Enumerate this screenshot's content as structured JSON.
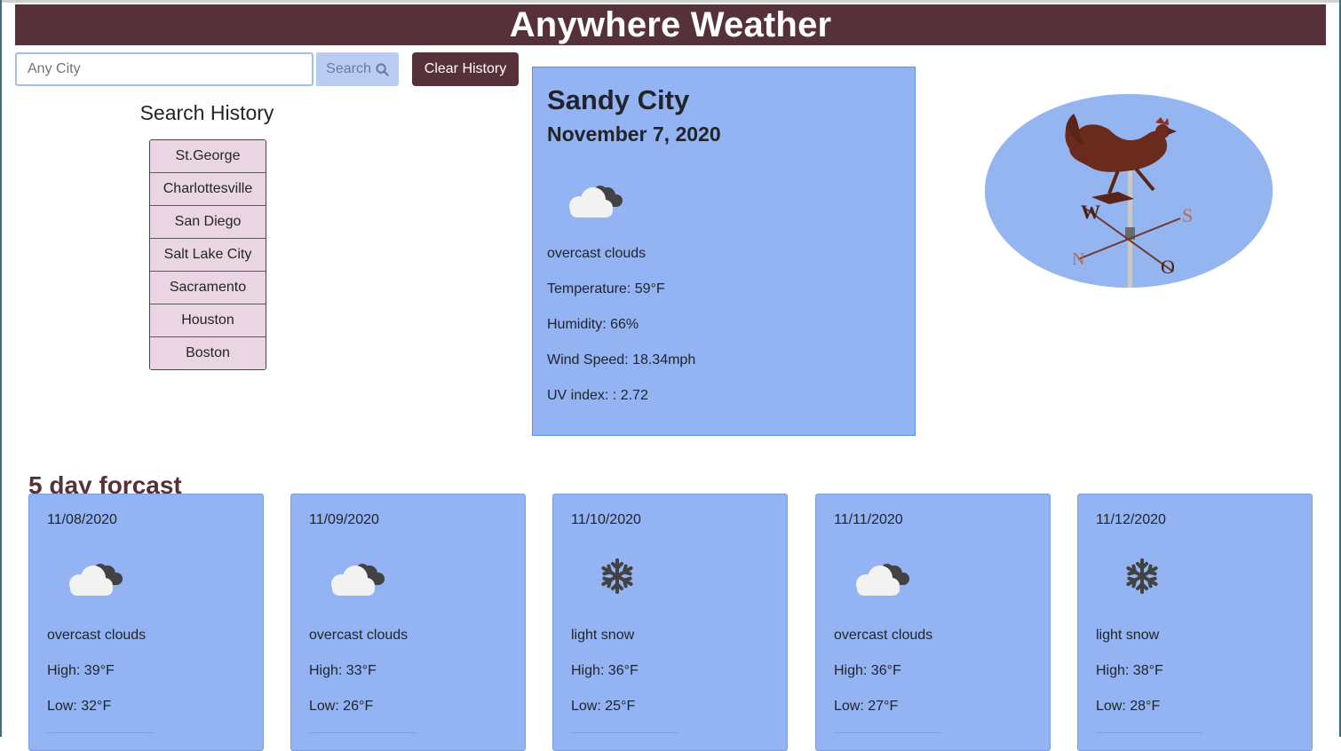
{
  "app": {
    "title": "Anywhere Weather"
  },
  "search": {
    "placeholder": "Any City",
    "value": "",
    "search_label": "Search",
    "clear_label": "Clear History"
  },
  "history": {
    "title": "Search History",
    "items": [
      "St.George",
      "Charlottesville",
      "San Diego",
      "Salt Lake City",
      "Sacramento",
      "Houston",
      "Boston"
    ]
  },
  "current": {
    "city": "Sandy City",
    "date": "November 7, 2020",
    "icon": "overcast-cloud-icon",
    "description": "overcast clouds",
    "temperature": "Temperature: 59°F",
    "humidity": "Humidity: 66%",
    "wind": "Wind Speed: 18.34mph",
    "uv": "UV index: : 2.72"
  },
  "forecast": {
    "title": "5 day forcast",
    "days": [
      {
        "date": "11/08/2020",
        "icon": "overcast-cloud-icon",
        "description": "overcast clouds",
        "high": "High: 39°F",
        "low": "Low: 32°F"
      },
      {
        "date": "11/09/2020",
        "icon": "overcast-cloud-icon",
        "description": "overcast clouds",
        "high": "High: 33°F",
        "low": "Low: 26°F"
      },
      {
        "date": "11/10/2020",
        "icon": "snowflake-icon",
        "description": "light snow",
        "high": "High: 36°F",
        "low": "Low: 25°F"
      },
      {
        "date": "11/11/2020",
        "icon": "overcast-cloud-icon",
        "description": "overcast clouds",
        "high": "High: 36°F",
        "low": "Low: 27°F"
      },
      {
        "date": "11/12/2020",
        "icon": "snowflake-icon",
        "description": "light snow",
        "high": "High: 38°F",
        "low": "Low: 28°F"
      }
    ]
  },
  "colors": {
    "brand": "#57313a",
    "card": "#93b3f2",
    "history_item": "#ead6e2"
  }
}
